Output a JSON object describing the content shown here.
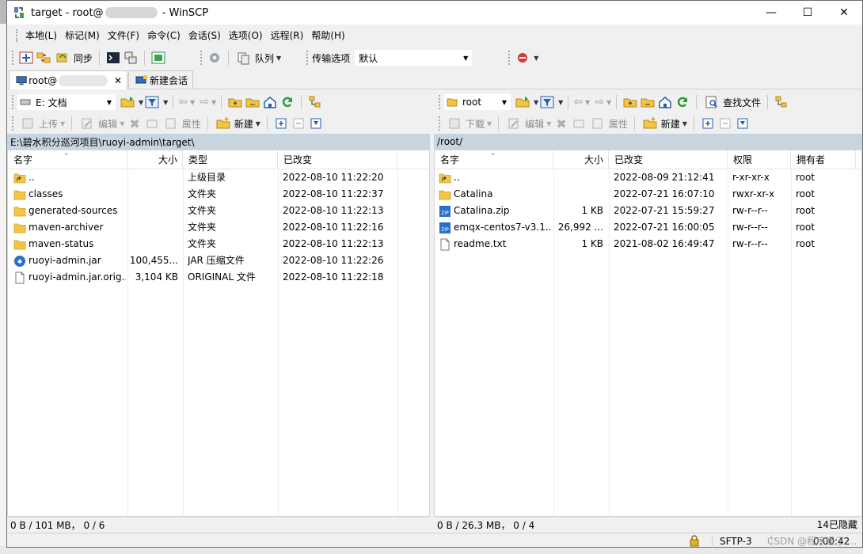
{
  "window": {
    "title_prefix": "target - root@",
    "title_suffix": " - WinSCP",
    "min": "—",
    "max": "☐",
    "close": "✕"
  },
  "menu": [
    "本地(L)",
    "标记(M)",
    "文件(F)",
    "命令(C)",
    "会话(S)",
    "选项(O)",
    "远程(R)",
    "帮助(H)"
  ],
  "toolbar1": {
    "sync_label": "同步",
    "queue_label": "队列",
    "transfer_options_label": "传输选项",
    "transfer_preset": "默认"
  },
  "tabs": {
    "session_prefix": "root@",
    "close": "✕",
    "new_session": "新建会话"
  },
  "left": {
    "drive": "E: 文档",
    "upload": "上传",
    "edit": "编辑",
    "properties": "属性",
    "new": "新建",
    "path": "E:\\碧水积分巡河项目\\ruoyi-admin\\target\\",
    "headers": {
      "name": "名字",
      "size": "大小",
      "type": "类型",
      "changed": "已改变"
    },
    "rows": [
      {
        "icon": "parent",
        "name": "..",
        "size": "",
        "type": "上级目录",
        "changed": "2022-08-10  11:22:20"
      },
      {
        "icon": "folder",
        "name": "classes",
        "size": "",
        "type": "文件夹",
        "changed": "2022-08-10  11:22:37"
      },
      {
        "icon": "folder",
        "name": "generated-sources",
        "size": "",
        "type": "文件夹",
        "changed": "2022-08-10  11:22:13"
      },
      {
        "icon": "folder",
        "name": "maven-archiver",
        "size": "",
        "type": "文件夹",
        "changed": "2022-08-10  11:22:16"
      },
      {
        "icon": "folder",
        "name": "maven-status",
        "size": "",
        "type": "文件夹",
        "changed": "2022-08-10  11:22:13"
      },
      {
        "icon": "jar",
        "name": "ruoyi-admin.jar",
        "size": "100,455...",
        "type": "JAR 压缩文件",
        "changed": "2022-08-10  11:22:26"
      },
      {
        "icon": "file",
        "name": "ruoyi-admin.jar.orig...",
        "size": "3,104 KB",
        "type": "ORIGINAL 文件",
        "changed": "2022-08-10  11:22:18"
      }
    ],
    "status": "0 B / 101 MB，  0 / 6"
  },
  "right": {
    "dir": "root",
    "find_files": "查找文件",
    "download": "下载",
    "edit": "编辑",
    "properties": "属性",
    "new": "新建",
    "path": "/root/",
    "headers": {
      "name": "名字",
      "size": "大小",
      "changed": "已改变",
      "rights": "权限",
      "owner": "拥有者"
    },
    "rows": [
      {
        "icon": "parent",
        "name": "..",
        "size": "",
        "changed": "2022-08-09 21:12:41",
        "rights": "r-xr-xr-x",
        "owner": "root"
      },
      {
        "icon": "folder",
        "name": "Catalina",
        "size": "",
        "changed": "2022-07-21 16:07:10",
        "rights": "rwxr-xr-x",
        "owner": "root"
      },
      {
        "icon": "zip",
        "name": "Catalina.zip",
        "size": "1 KB",
        "changed": "2022-07-21 15:59:27",
        "rights": "rw-r--r--",
        "owner": "root"
      },
      {
        "icon": "zip",
        "name": "emqx-centos7-v3.1....",
        "size": "26,992 ...",
        "changed": "2022-07-21 16:00:05",
        "rights": "rw-r--r--",
        "owner": "root"
      },
      {
        "icon": "file",
        "name": "readme.txt",
        "size": "1 KB",
        "changed": "2021-08-02 16:49:47",
        "rights": "rw-r--r--",
        "owner": "root"
      }
    ],
    "status": "0 B / 26.3 MB，  0 / 4",
    "hidden": "14已隐藏"
  },
  "bottom": {
    "protocol": "SFTP-3",
    "timer": "0:00:42",
    "watermark": "CSDN @程序媛了...."
  },
  "colors": {
    "path_bar": "#c8d4e0",
    "folder": "#f4c542",
    "accent": "#2a6fc9"
  }
}
